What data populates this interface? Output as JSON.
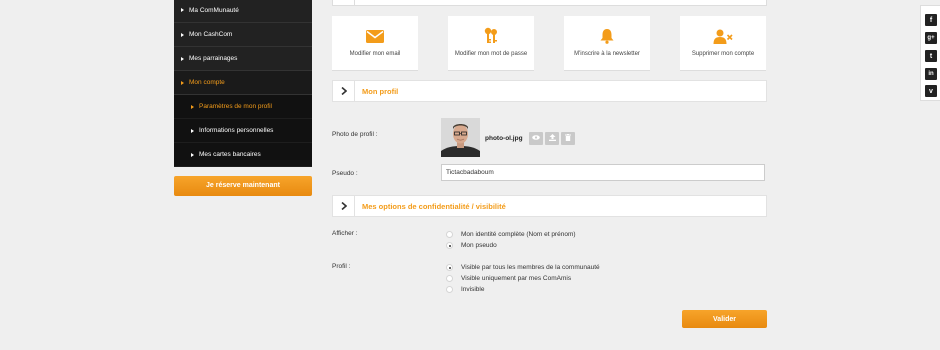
{
  "sidebar": {
    "items": [
      {
        "label": "Ma ComMunauté"
      },
      {
        "label": "Mon CashCom"
      },
      {
        "label": "Mes parrainages"
      },
      {
        "label": "Mon compte"
      },
      {
        "label": "Paramètres de mon profil"
      },
      {
        "label": "Informations personnelles"
      },
      {
        "label": "Mes cartes bancaires"
      }
    ],
    "reserve_label": "Je réserve maintenant"
  },
  "cards": [
    {
      "label": "Modifier mon email",
      "icon": "envelope-icon"
    },
    {
      "label": "Modifier mon mot de passe",
      "icon": "keys-icon"
    },
    {
      "label": "M'inscrire à la newsletter",
      "icon": "bell-icon"
    },
    {
      "label": "Supprimer mon compte",
      "icon": "remove-user-icon"
    }
  ],
  "profile": {
    "section_title": "Mon profil",
    "photo_label": "Photo de profil :",
    "file_name": "photo-ol.jpg",
    "pseudo_label": "Pseudo :",
    "pseudo_value": "Tictacbadaboum"
  },
  "privacy": {
    "section_title": "Mes options de confidentialité / visibilité",
    "afficher_label": "Afficher :",
    "afficher_options": [
      {
        "label": "Mon identité complète (Nom et prénom)",
        "checked": false
      },
      {
        "label": "Mon pseudo",
        "checked": true
      }
    ],
    "profil_label": "Profil :",
    "profil_options": [
      {
        "label": "Visible par tous les membres de la communauté",
        "checked": true
      },
      {
        "label": "Visible uniquement par mes ComAmis",
        "checked": false
      },
      {
        "label": "Invisible",
        "checked": false
      }
    ],
    "submit_label": "Valider"
  },
  "social": {
    "items": [
      {
        "icon": "facebook-icon",
        "glyph": "f"
      },
      {
        "icon": "google-plus-icon",
        "glyph": "g+"
      },
      {
        "icon": "twitter-icon",
        "glyph": "t"
      },
      {
        "icon": "linkedin-icon",
        "glyph": "in"
      },
      {
        "icon": "viadeo-icon",
        "glyph": "v"
      }
    ]
  },
  "colors": {
    "accent": "#f39c1a",
    "sidebar_bg": "#222222",
    "page_bg": "#efefef"
  }
}
